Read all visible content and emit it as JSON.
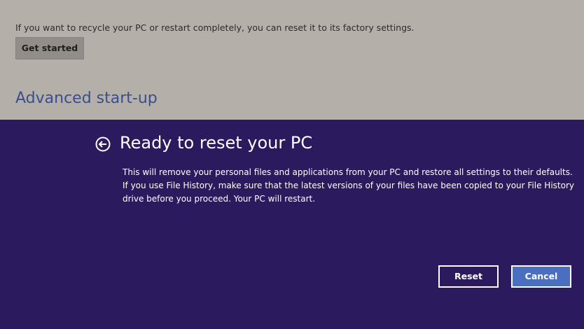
{
  "settings": {
    "reset_description": "If you want to recycle your PC or restart completely, you can reset it to its factory settings.",
    "get_started_label": "Get started",
    "advanced_startup_heading": "Advanced start-up"
  },
  "dialog": {
    "back_icon": "back-arrow-circle-icon",
    "title": "Ready to reset your PC",
    "body": "This will remove your personal files and applications from your PC and restore all settings to their defaults. If you use File History, make sure that the latest versions of your files have been copied to your File History drive before you proceed. Your PC will restart.",
    "reset_label": "Reset",
    "cancel_label": "Cancel"
  },
  "colors": {
    "settings_background": "#b4b0a9",
    "dialog_background": "#2b1a5e",
    "accent": "#4a6fc0",
    "heading": "#3a4f8a"
  }
}
